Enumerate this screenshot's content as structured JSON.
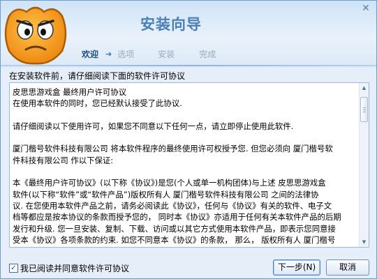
{
  "window": {
    "title": "安装向导",
    "close_glyph": "✕"
  },
  "steps": [
    {
      "label": "欢迎",
      "active": true
    },
    {
      "label": "选项",
      "active": false
    },
    {
      "label": "安装",
      "active": false
    },
    {
      "label": "完成",
      "active": false
    }
  ],
  "step_arrow": "➔",
  "instruction": "在安装软件前，请仔细阅读下面的软件许可协议",
  "license": {
    "lines": [
      "皮思思游戏盒 最终用户许可协议",
      "在使用本软件的同时，您已经默认接受了此协议.",
      "",
      "请仔细阅读以下使用许可，如果您不同意以下任何一点，请立即停止使用此软件.",
      "",
      "厦门楷号软件科技有限公司 将本软件程序的最终使用许可权授予您. 但您必须向 厦门楷号软",
      "件科技有限公司 作以下保证:",
      "",
      "本《最终用户许可协议》(以下称《协议》)是您(个人或单一机构团体)与上述 皮思思游戏盒",
      "软件(以下称“软件”或“软件产品”)版权所有人 厦门楷号软件科技有限公司 之间的法律协",
      "议. 在您使用本软件产品之前，请务必阅读此《协议》，任何与《协议》有关的软件、电子文",
      "档等都应是按本协议的条款而授予您的， 同时本《协议》亦适用于任何有关本软件产品的后期",
      "发行和升级. 您一旦安装、复制、下载、访问或以其它方式使用本软件产品，即表示您同意接",
      "受本《协议》各项条款的约束. 如您不同意本《协议》的条款， 那么， 版权所有人 厦门楷号"
    ]
  },
  "scrollbar": {
    "up_glyph": "▲",
    "down_glyph": "▼"
  },
  "agree": {
    "checked": true,
    "check_glyph": "✓",
    "label": "我已阅读并同意软件许可协议"
  },
  "buttons": {
    "next": "下一步(N)",
    "cancel": "取消"
  },
  "colors": {
    "accent": "#4a7fb7",
    "mascot": "#f39a1e",
    "active_step": "#1e4f86"
  }
}
